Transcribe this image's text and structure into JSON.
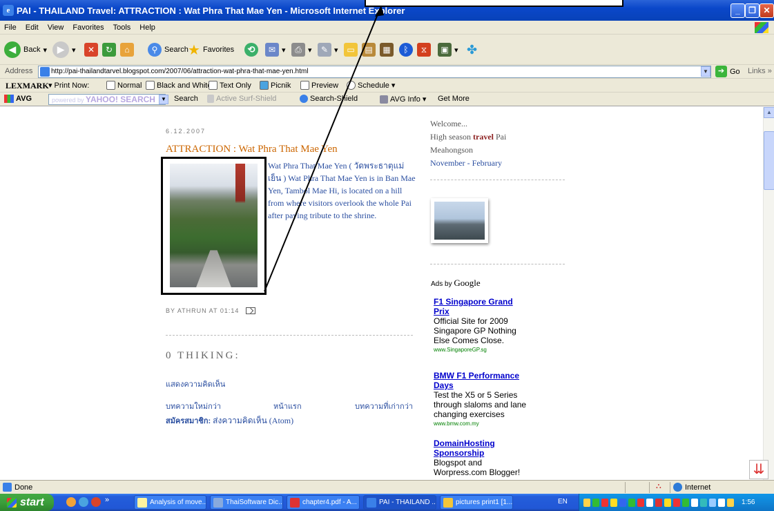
{
  "window": {
    "title": "PAI - THAILAND Travel: ATTRACTION : Wat Phra That Mae Yen - Microsoft Internet Explorer"
  },
  "menu": [
    "File",
    "Edit",
    "View",
    "Favorites",
    "Tools",
    "Help"
  ],
  "toolbar": {
    "back": "Back",
    "search": "Search",
    "favorites": "Favorites"
  },
  "address": {
    "label": "Address",
    "url": "http://pai-thailandtarvel.blogspot.com/2007/06/attraction-wat-phra-that-mae-yen.html",
    "go": "Go",
    "links": "Links"
  },
  "lexmark": {
    "brand": "LEXMARK",
    "print_now": "Print Now:",
    "normal": "Normal",
    "bw": "Black and White",
    "text_only": "Text Only",
    "picnik": "Picnik",
    "preview": "Preview",
    "schedule": "Schedule"
  },
  "avg": {
    "brand": "AVG",
    "powered": "powered by",
    "yahoo": "YAHOO! SEARCH",
    "search": "Search",
    "active": "Active",
    "surf_shield": "Surf-Shield",
    "search_shield": "Search-Shield",
    "avg_info": "AVG Info",
    "get_more": "Get More"
  },
  "post": {
    "date": "6.12.2007",
    "title": "ATTRACTION : Wat Phra That Mae Yen",
    "body": "Wat Phra That Mae Yen ( วัดพระธาตุแม่เย็น ) Wat Phra That Mae Yen is in Ban Mae Yen, Tambol Mae Hi, is located on a hill from where visitors overlook the whole Pai after paying tribute to the shrine.",
    "footer": "BY ATHRUN AT 01:14",
    "comments_head": "0 THIKING:",
    "show_comments": "แสดงความคิดเห็น",
    "nav_newer": "บทความใหม่กว่า",
    "nav_home": "หน้าแรก",
    "nav_older": "บทความที่เก่ากว่า",
    "subscribe_label": "สมัครสมาชิก:",
    "subscribe_link": "ส่งความคิดเห็น (Atom)"
  },
  "sidebar": {
    "welcome": "Welcome...",
    "season_pre": "High season",
    "season_hl": "travel",
    "season_post": "Pai",
    "place": "Meahongson",
    "months": "November - February",
    "ads_by": "Ads by",
    "google": "Google",
    "ads": [
      {
        "title": "F1 Singapore Grand Prix",
        "desc": "Official Site for 2009 Singapore GP Nothing Else Comes Close.",
        "url": "www.SingaporeGP.sg"
      },
      {
        "title": "BMW F1 Performance Days",
        "desc": "Test the X5 or 5 Series through slaloms and lane changing exercises",
        "url": "www.bmw.com.my"
      },
      {
        "title": "DomainHosting Sponsorship",
        "desc": "Blogspot and Worpress.com Blogger!",
        "url": ""
      }
    ]
  },
  "status": {
    "done": "Done",
    "zone": "Internet"
  },
  "taskbar": {
    "start": "start",
    "tasks": [
      "Analysis of move...",
      "ThaiSoftware Dic...",
      "chapter4.pdf - A...",
      "PAI - THAILAND ...",
      "pictures print1 [1..."
    ],
    "lang": "EN",
    "clock": "1:56"
  },
  "colors": {
    "title_orange": "#cc6600",
    "link_blue": "#2a4ea0",
    "ad_blue": "#0000cc",
    "xp_blue": "#245edb"
  }
}
